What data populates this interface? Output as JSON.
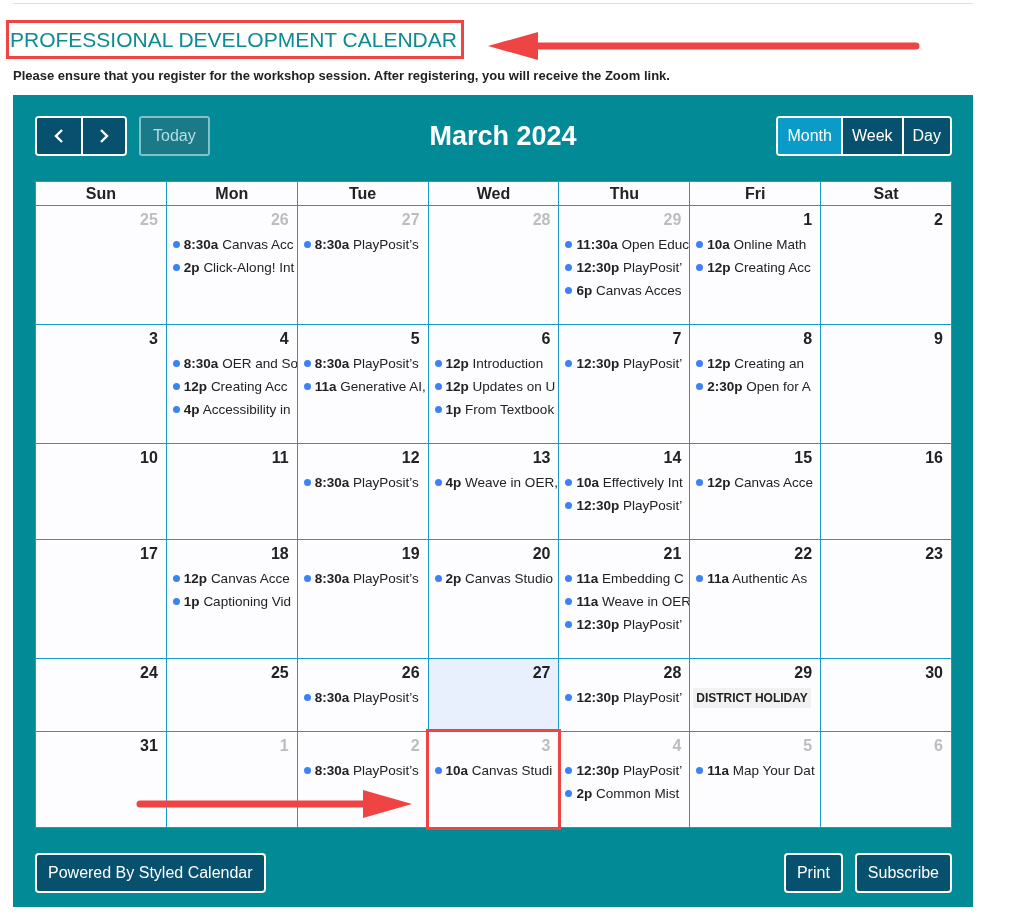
{
  "page_title": {
    "text": "PROFESSIONAL DEVELOPMENT CALENDAR",
    "callout": true
  },
  "notice": "Please ensure that you register for the workshop session. After registering, you will receive the Zoom link.",
  "toolbar": {
    "today_button": {
      "label": "Today",
      "disabled": true
    },
    "month_title": "March 2024",
    "views": [
      {
        "label": "Month",
        "selected": true
      },
      {
        "label": "Week",
        "selected": false
      },
      {
        "label": "Day",
        "selected": false
      }
    ]
  },
  "weekdays": [
    "Sun",
    "Mon",
    "Tue",
    "Wed",
    "Thu",
    "Fri",
    "Sat"
  ],
  "weeks": [
    {
      "days": [
        {
          "day": "25",
          "other_month": true,
          "today": false,
          "callout": false
        },
        {
          "day": "26",
          "other_month": true,
          "today": false,
          "callout": false,
          "events": [
            {
              "kind": "timed",
              "time": "8:30a",
              "title": "Canvas Acc"
            },
            {
              "kind": "timed",
              "time": "2p",
              "title": "Click-Along! Int"
            }
          ]
        },
        {
          "day": "27",
          "other_month": true,
          "today": false,
          "callout": false,
          "events": [
            {
              "kind": "timed",
              "time": "8:30a",
              "title": "PlayPosit’s"
            }
          ]
        },
        {
          "day": "28",
          "other_month": true,
          "today": false,
          "callout": false
        },
        {
          "day": "29",
          "other_month": true,
          "today": false,
          "callout": false,
          "events": [
            {
              "kind": "timed",
              "time": "11:30a",
              "title": "Open Educ"
            },
            {
              "kind": "timed",
              "time": "12:30p",
              "title": "PlayPosit’"
            },
            {
              "kind": "timed",
              "time": "6p",
              "title": "Canvas Acces"
            }
          ]
        },
        {
          "day": "1",
          "other_month": false,
          "today": false,
          "callout": false,
          "events": [
            {
              "kind": "timed",
              "time": "10a",
              "title": "Online Math"
            },
            {
              "kind": "timed",
              "time": "12p",
              "title": "Creating Acc"
            }
          ]
        },
        {
          "day": "2",
          "other_month": false,
          "today": false,
          "callout": false
        }
      ]
    },
    {
      "days": [
        {
          "day": "3",
          "other_month": false,
          "today": false,
          "callout": false
        },
        {
          "day": "4",
          "other_month": false,
          "today": false,
          "callout": false,
          "events": [
            {
              "kind": "timed",
              "time": "8:30a",
              "title": "OER and So"
            },
            {
              "kind": "timed",
              "time": "12p",
              "title": "Creating Acc"
            },
            {
              "kind": "timed",
              "time": "4p",
              "title": "Accessibility in"
            }
          ]
        },
        {
          "day": "5",
          "other_month": false,
          "today": false,
          "callout": false,
          "events": [
            {
              "kind": "timed",
              "time": "8:30a",
              "title": "PlayPosit’s"
            },
            {
              "kind": "timed",
              "time": "11a",
              "title": "Generative AI,"
            }
          ]
        },
        {
          "day": "6",
          "other_month": false,
          "today": false,
          "callout": false,
          "events": [
            {
              "kind": "timed",
              "time": "12p",
              "title": "Introduction"
            },
            {
              "kind": "timed",
              "time": "12p",
              "title": "Updates on U"
            },
            {
              "kind": "timed",
              "time": "1p",
              "title": "From Textbook"
            }
          ]
        },
        {
          "day": "7",
          "other_month": false,
          "today": false,
          "callout": false,
          "events": [
            {
              "kind": "timed",
              "time": "12:30p",
              "title": "PlayPosit’"
            }
          ]
        },
        {
          "day": "8",
          "other_month": false,
          "today": false,
          "callout": false,
          "events": [
            {
              "kind": "timed",
              "time": "12p",
              "title": "Creating an"
            },
            {
              "kind": "timed",
              "time": "2:30p",
              "title": "Open for A"
            }
          ]
        },
        {
          "day": "9",
          "other_month": false,
          "today": false,
          "callout": false
        }
      ]
    },
    {
      "days": [
        {
          "day": "10",
          "other_month": false,
          "today": false,
          "callout": false
        },
        {
          "day": "11",
          "other_month": false,
          "today": false,
          "callout": false
        },
        {
          "day": "12",
          "other_month": false,
          "today": false,
          "callout": false,
          "events": [
            {
              "kind": "timed",
              "time": "8:30a",
              "title": "PlayPosit’s"
            }
          ]
        },
        {
          "day": "13",
          "other_month": false,
          "today": false,
          "callout": false,
          "events": [
            {
              "kind": "timed",
              "time": "4p",
              "title": "Weave in OER,"
            }
          ]
        },
        {
          "day": "14",
          "other_month": false,
          "today": false,
          "callout": false,
          "events": [
            {
              "kind": "timed",
              "time": "10a",
              "title": "Effectively Int"
            },
            {
              "kind": "timed",
              "time": "12:30p",
              "title": "PlayPosit’"
            }
          ]
        },
        {
          "day": "15",
          "other_month": false,
          "today": false,
          "callout": false,
          "events": [
            {
              "kind": "timed",
              "time": "12p",
              "title": "Canvas Acce"
            }
          ]
        },
        {
          "day": "16",
          "other_month": false,
          "today": false,
          "callout": false
        }
      ]
    },
    {
      "days": [
        {
          "day": "17",
          "other_month": false,
          "today": false,
          "callout": false
        },
        {
          "day": "18",
          "other_month": false,
          "today": false,
          "callout": false,
          "events": [
            {
              "kind": "timed",
              "time": "12p",
              "title": "Canvas Acce"
            },
            {
              "kind": "timed",
              "time": "1p",
              "title": "Captioning Vid"
            }
          ]
        },
        {
          "day": "19",
          "other_month": false,
          "today": false,
          "callout": false,
          "events": [
            {
              "kind": "timed",
              "time": "8:30a",
              "title": "PlayPosit’s"
            }
          ]
        },
        {
          "day": "20",
          "other_month": false,
          "today": false,
          "callout": false,
          "events": [
            {
              "kind": "timed",
              "time": "2p",
              "title": "Canvas Studio"
            }
          ]
        },
        {
          "day": "21",
          "other_month": false,
          "today": false,
          "callout": false,
          "events": [
            {
              "kind": "timed",
              "time": "11a",
              "title": "Embedding C"
            },
            {
              "kind": "timed",
              "time": "11a",
              "title": "Weave in OER"
            },
            {
              "kind": "timed",
              "time": "12:30p",
              "title": "PlayPosit’"
            }
          ]
        },
        {
          "day": "22",
          "other_month": false,
          "today": false,
          "callout": false,
          "events": [
            {
              "kind": "timed",
              "time": "11a",
              "title": "Authentic As"
            }
          ]
        },
        {
          "day": "23",
          "other_month": false,
          "today": false,
          "callout": false
        }
      ]
    },
    {
      "days": [
        {
          "day": "24",
          "other_month": false,
          "today": false,
          "callout": false
        },
        {
          "day": "25",
          "other_month": false,
          "today": false,
          "callout": false
        },
        {
          "day": "26",
          "other_month": false,
          "today": false,
          "callout": false,
          "events": [
            {
              "kind": "timed",
              "time": "8:30a",
              "title": "PlayPosit’s"
            }
          ]
        },
        {
          "day": "27",
          "other_month": false,
          "today": true,
          "callout": false
        },
        {
          "day": "28",
          "other_month": false,
          "today": false,
          "callout": false,
          "events": [
            {
              "kind": "timed",
              "time": "12:30p",
              "title": "PlayPosit’"
            }
          ]
        },
        {
          "day": "29",
          "other_month": false,
          "today": false,
          "callout": false,
          "events": [
            {
              "kind": "allday",
              "title": "DISTRICT HOLIDAY"
            }
          ]
        },
        {
          "day": "30",
          "other_month": false,
          "today": false,
          "callout": false
        }
      ]
    },
    {
      "days": [
        {
          "day": "31",
          "other_month": false,
          "today": false,
          "callout": false
        },
        {
          "day": "1",
          "other_month": true,
          "today": false,
          "callout": false
        },
        {
          "day": "2",
          "other_month": true,
          "today": false,
          "callout": false,
          "events": [
            {
              "kind": "timed",
              "time": "8:30a",
              "title": "PlayPosit’s"
            }
          ]
        },
        {
          "day": "3",
          "other_month": true,
          "today": false,
          "callout": true,
          "events": [
            {
              "kind": "timed",
              "time": "10a",
              "title": "Canvas Studi"
            }
          ]
        },
        {
          "day": "4",
          "other_month": true,
          "today": false,
          "callout": false,
          "events": [
            {
              "kind": "timed",
              "time": "12:30p",
              "title": "PlayPosit’"
            },
            {
              "kind": "timed",
              "time": "2p",
              "title": "Common Mist"
            }
          ]
        },
        {
          "day": "5",
          "other_month": true,
          "today": false,
          "callout": false,
          "events": [
            {
              "kind": "timed",
              "time": "11a",
              "title": "Map Your Dat"
            }
          ]
        },
        {
          "day": "6",
          "other_month": true,
          "today": false,
          "callout": false
        }
      ]
    }
  ],
  "footer": {
    "powered_by": "Powered By Styled Calendar",
    "buttons": [
      "Print",
      "Subscribe"
    ]
  }
}
